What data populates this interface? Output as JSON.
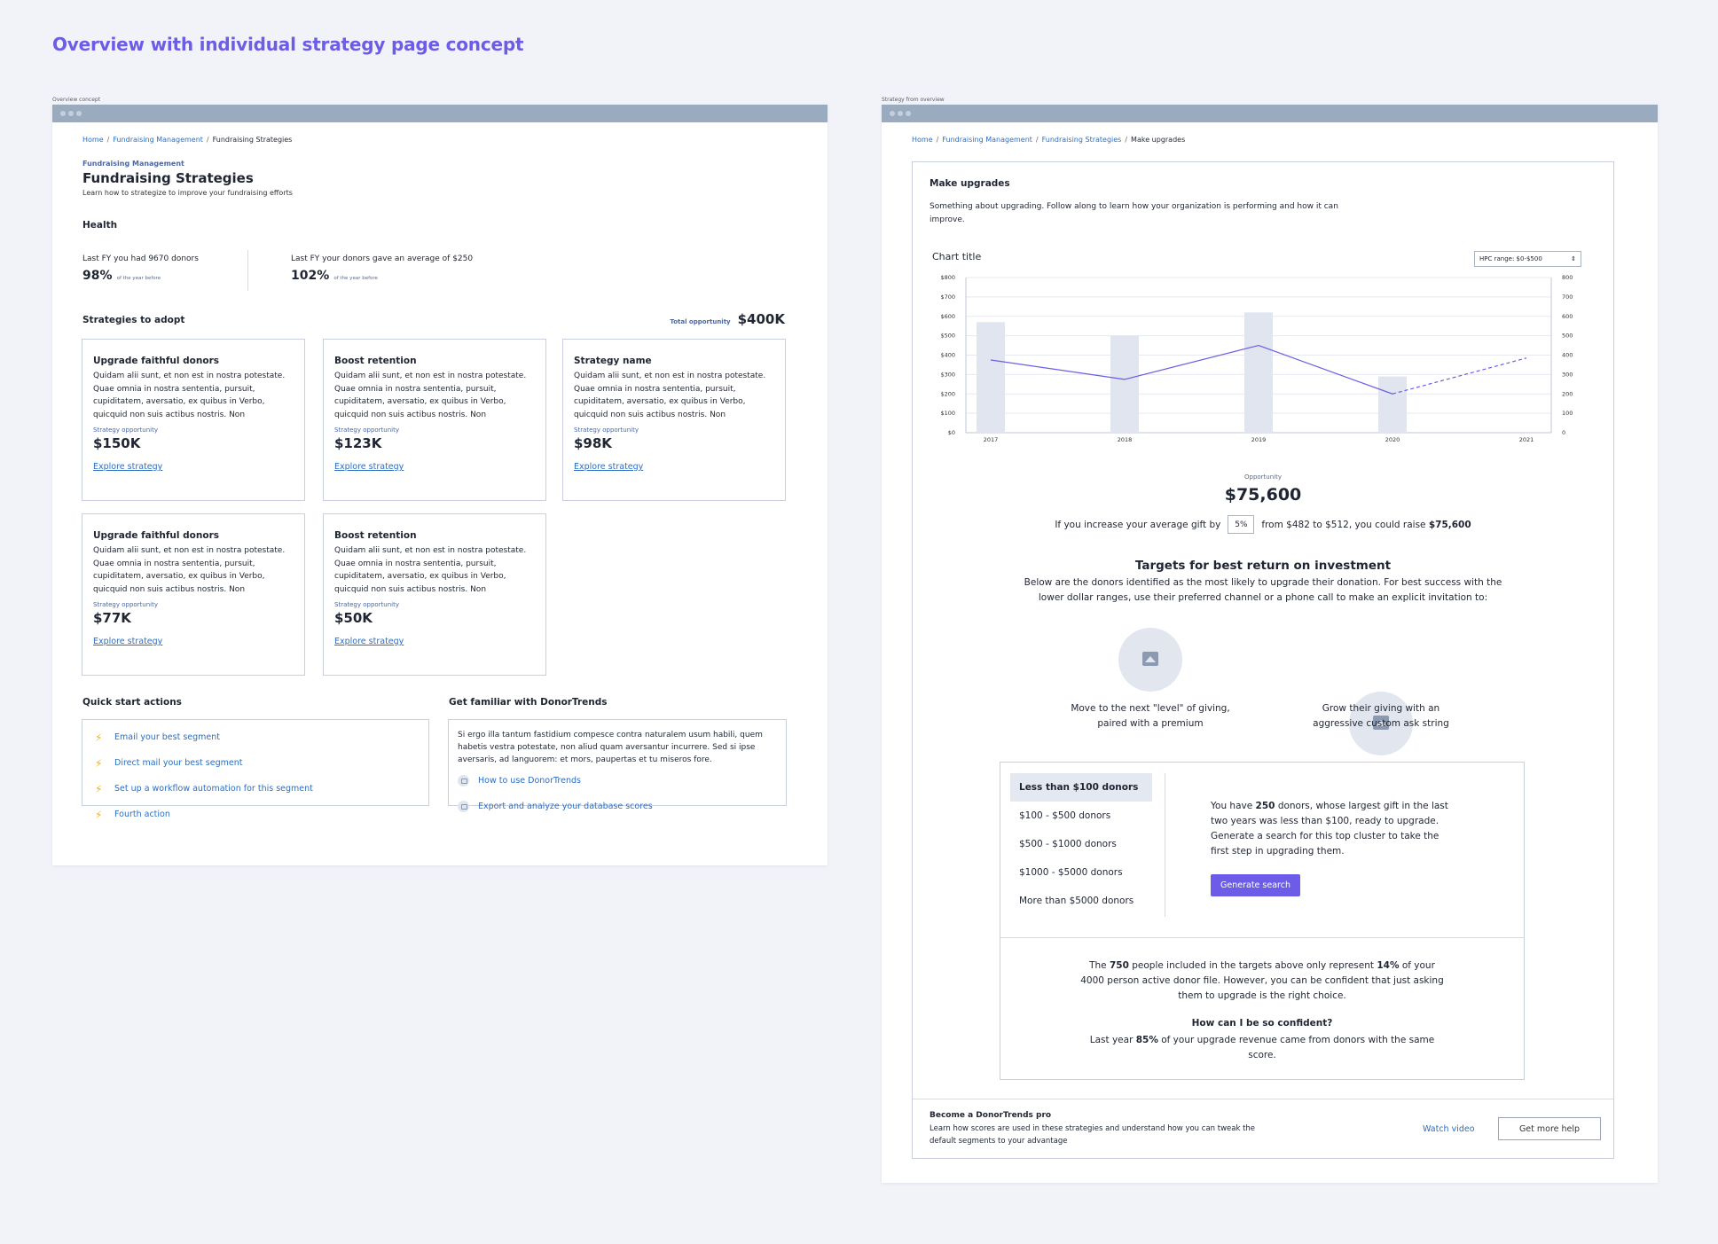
{
  "page_title": "Overview with individual strategy page concept",
  "left": {
    "frame_label": "Overview concept",
    "breadcrumb": {
      "home": "Home",
      "mgmt": "Fundraising Management",
      "current": "Fundraising Strategies"
    },
    "overline": "Fundraising Management",
    "title": "Fundraising Strategies",
    "subtitle": "Learn how to strategize to improve your fundraising efforts",
    "health": {
      "heading": "Health",
      "stats": [
        {
          "label": "Last FY you had 9670 donors",
          "value": "98%",
          "caption": "of the year before"
        },
        {
          "label": "Last FY your donors gave an average of $250",
          "value": "102%",
          "caption": "of the year before"
        }
      ]
    },
    "strategies": {
      "heading": "Strategies to adopt",
      "total_label": "Total opportunity",
      "total_value": "$400K",
      "opportunity_label": "Strategy opportunity",
      "link_label": "Explore strategy",
      "cards": [
        {
          "title": "Upgrade faithful donors",
          "body": "Quidam alii sunt, et non est in nostra potestate. Quae omnia in nostra sententia, pursuit, cupiditatem, aversatio, ex quibus in Verbo, quicquid non suis actibus nostris. Non",
          "value": "$150K"
        },
        {
          "title": "Boost retention",
          "body": "Quidam alii sunt, et non est in nostra potestate. Quae omnia in nostra sententia, pursuit, cupiditatem, aversatio, ex quibus in Verbo, quicquid non suis actibus nostris. Non",
          "value": "$123K"
        },
        {
          "title": "Strategy name",
          "body": "Quidam alii sunt, et non est in nostra potestate. Quae omnia in nostra sententia, pursuit, cupiditatem, aversatio, ex quibus in Verbo, quicquid non suis actibus nostris. Non",
          "value": "$98K"
        },
        {
          "title": "Upgrade faithful donors",
          "body": "Quidam alii sunt, et non est in nostra potestate. Quae omnia in nostra sententia, pursuit, cupiditatem, aversatio, ex quibus in Verbo, quicquid non suis actibus nostris. Non",
          "value": "$77K"
        },
        {
          "title": "Boost retention",
          "body": "Quidam alii sunt, et non est in nostra potestate. Quae omnia in nostra sententia, pursuit, cupiditatem, aversatio, ex quibus in Verbo, quicquid non suis actibus nostris. Non",
          "value": "$50K"
        }
      ]
    },
    "quick_start": {
      "heading": "Quick start actions",
      "items": [
        "Email your best segment",
        "Direct mail your best segment",
        "Set up a workflow automation for this segment",
        "Fourth action"
      ]
    },
    "familiar": {
      "heading": "Get familiar with DonorTrends",
      "text": "Si ergo illa tantum fastidium compesce contra naturalem usum habili, quem habetis vestra potestate, non aliud quam aversantur incurrere. Sed si ipse aversaris, ad languorem: et mors, paupertas et tu miseros fore.",
      "links": [
        "How to use DonorTrends",
        "Export and analyze your database scores"
      ]
    }
  },
  "right": {
    "frame_label": "Strategy from overview",
    "breadcrumb": {
      "home": "Home",
      "mgmt": "Fundraising Management",
      "strategies": "Fundraising Strategies",
      "current": "Make upgrades"
    },
    "title": "Make upgrades",
    "intro": "Something about upgrading. Follow along to learn how your organization is performing and how it can improve.",
    "chart_title": "Chart title",
    "range_select": "HPC range: $0-$500",
    "opportunity_label": "Opportunity",
    "opportunity_value": "$75,600",
    "sentence": {
      "pre": "If you increase your average gift by",
      "pct": "5%",
      "mid": "from $482 to $512, you could raise",
      "amount": "$75,600"
    },
    "targets": {
      "heading": "Targets for best return on investment",
      "text": "Below are the donors identified as the most likely to upgrade their donation. For best success with the lower dollar ranges, use their preferred channel or a phone call to make an explicit invitation to:",
      "items": [
        "Move to the next \"level\" of giving, paired with a premium",
        "Grow their giving with an aggressive custom ask string"
      ]
    },
    "segments": [
      "Less than $100 donors",
      "$100 - $500 donors",
      "$500 - $1000 donors",
      "$1000 - $5000 donors",
      "More than $5000 donors"
    ],
    "segment_detail": {
      "pre": "You have",
      "count": "250",
      "post": "donors, whose largest gift in the last two years was less than $100, ready to upgrade. Generate a search for this top cluster to take the first step in upgrading them.",
      "button": "Generate search"
    },
    "confidence": {
      "p1_pre": "The",
      "p1_count": "750",
      "p1_mid": "people included in the targets above only represent",
      "p1_pct": "14%",
      "p1_post": "of your 4000 person active donor file. However, you can be confident that just asking them to upgrade is the right choice.",
      "question": "How can I be so confident?",
      "p2_pre": "Last year",
      "p2_pct": "85%",
      "p2_post": "of your upgrade revenue came from donors with the same score."
    },
    "pro": {
      "title": "Become a DonorTrends pro",
      "text": "Learn how scores are used in these strategies and understand how you can tweak the default segments to your advantage",
      "watch": "Watch video",
      "help": "Get more help"
    }
  },
  "chart_data": {
    "type": "bar",
    "title": "Chart title",
    "categories": [
      "2017",
      "2018",
      "2019",
      "2020",
      "2021"
    ],
    "series": [
      {
        "kind": "bar",
        "values": [
          570,
          500,
          620,
          290,
          null
        ],
        "color": "#e1e5ef"
      },
      {
        "kind": "line",
        "values": [
          375,
          275,
          450,
          200,
          385
        ],
        "color": "#6c5ce7",
        "projected_from_index": 3
      }
    ],
    "y_left_ticks": [
      "$0",
      "$100",
      "$200",
      "$300",
      "$400",
      "$500",
      "$600",
      "$700",
      "$800"
    ],
    "y_right_ticks": [
      "0",
      "100",
      "200",
      "300",
      "400",
      "500",
      "600",
      "700",
      "800"
    ],
    "ylim": [
      0,
      800
    ],
    "grid": true
  }
}
